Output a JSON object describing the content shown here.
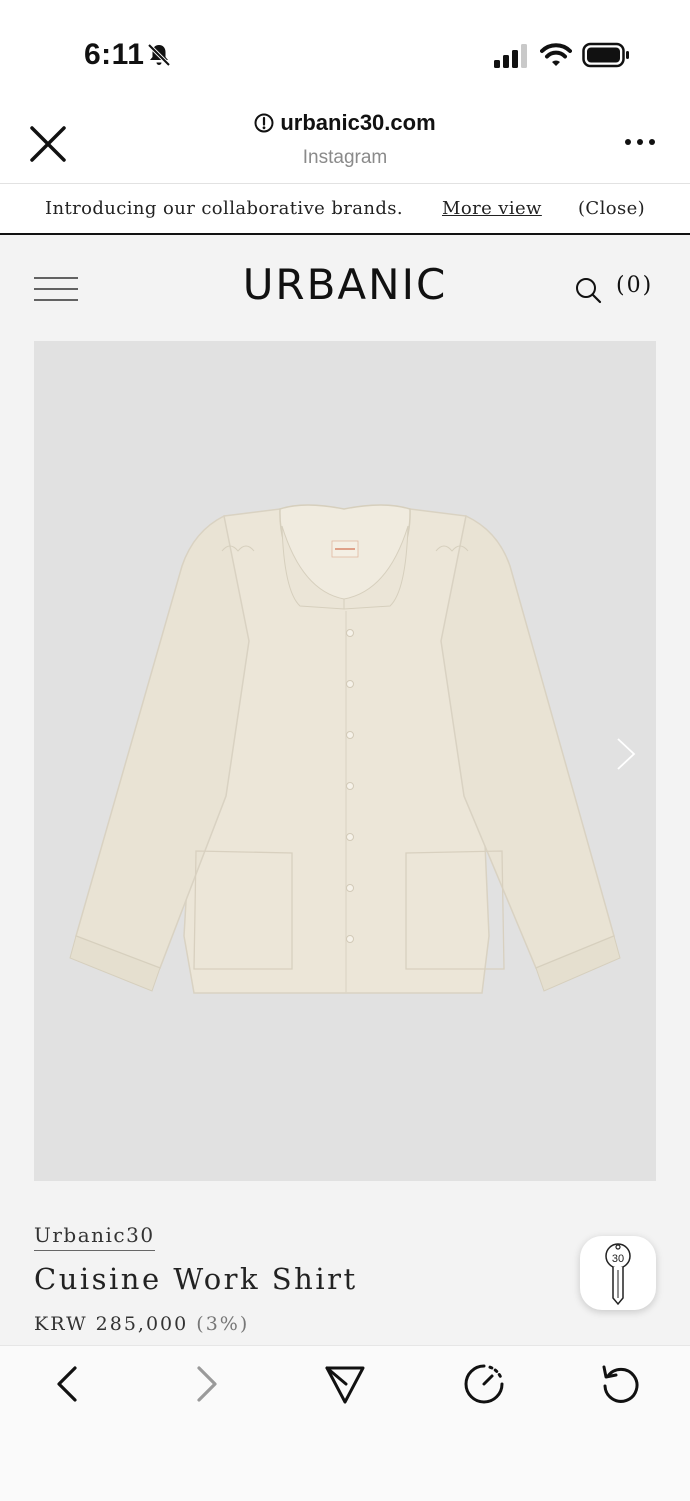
{
  "status_bar": {
    "time": "6:11"
  },
  "browser": {
    "url": "urbanic30.com",
    "source": "Instagram"
  },
  "banner": {
    "text": "Introducing our collaborative brands.",
    "more_label": "More view",
    "close_label": "(Close)"
  },
  "site": {
    "logo": "URBANIC",
    "cart_count": "(0)"
  },
  "product": {
    "brand": "Urbanic30",
    "name": "Cuisine Work Shirt",
    "price": "KRW 285,000",
    "discount": "(3%)",
    "key_badge": "30"
  },
  "colors": {
    "site_bg": "#f3f3f3",
    "image_bg": "#e1e1e1",
    "shirt": "#ece6d8"
  }
}
